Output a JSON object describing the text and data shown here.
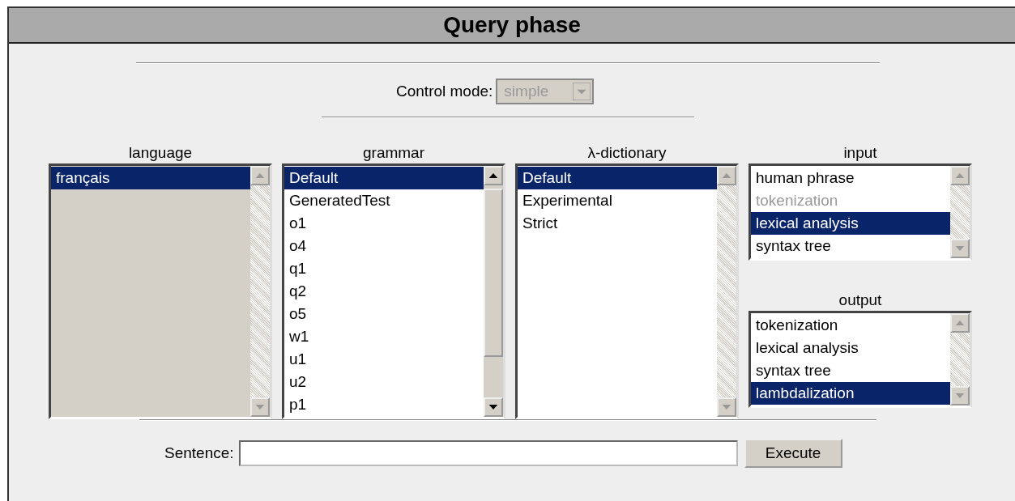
{
  "window": {
    "title": "Query phase"
  },
  "control_mode": {
    "label": "Control mode:",
    "value": "simple",
    "disabled": true
  },
  "lists": [
    {
      "heading": "language",
      "disabled": true,
      "scrollable": false,
      "items": [
        {
          "label": "français",
          "selected": true,
          "disabled": false
        }
      ]
    },
    {
      "heading": "grammar",
      "disabled": false,
      "scrollable": true,
      "items": [
        {
          "label": "Default",
          "selected": true,
          "disabled": false
        },
        {
          "label": "GeneratedTest",
          "selected": false,
          "disabled": false
        },
        {
          "label": "o1",
          "selected": false,
          "disabled": false
        },
        {
          "label": "o4",
          "selected": false,
          "disabled": false
        },
        {
          "label": "q1",
          "selected": false,
          "disabled": false
        },
        {
          "label": "q2",
          "selected": false,
          "disabled": false
        },
        {
          "label": "o5",
          "selected": false,
          "disabled": false
        },
        {
          "label": "w1",
          "selected": false,
          "disabled": false
        },
        {
          "label": "u1",
          "selected": false,
          "disabled": false
        },
        {
          "label": "u2",
          "selected": false,
          "disabled": false
        },
        {
          "label": "p1",
          "selected": false,
          "disabled": false
        }
      ]
    },
    {
      "heading": "λ-dictionary",
      "disabled": false,
      "scrollable": false,
      "items": [
        {
          "label": "Default",
          "selected": true,
          "disabled": false
        },
        {
          "label": "Experimental",
          "selected": false,
          "disabled": false
        },
        {
          "label": "Strict",
          "selected": false,
          "disabled": false
        }
      ]
    },
    {
      "heading": "input",
      "disabled": false,
      "scrollable": false,
      "items": [
        {
          "label": "human phrase",
          "selected": false,
          "disabled": false
        },
        {
          "label": "tokenization",
          "selected": false,
          "disabled": true
        },
        {
          "label": "lexical analysis",
          "selected": true,
          "disabled": false
        },
        {
          "label": "syntax tree",
          "selected": false,
          "disabled": false
        }
      ]
    },
    {
      "heading": "output",
      "disabled": false,
      "scrollable": false,
      "items": [
        {
          "label": "tokenization",
          "selected": false,
          "disabled": false
        },
        {
          "label": "lexical analysis",
          "selected": false,
          "disabled": false
        },
        {
          "label": "syntax tree",
          "selected": false,
          "disabled": false
        },
        {
          "label": "lambdalization",
          "selected": true,
          "disabled": false
        }
      ]
    }
  ],
  "sentence": {
    "label": "Sentence:"
  },
  "execute_button": "Execute"
}
